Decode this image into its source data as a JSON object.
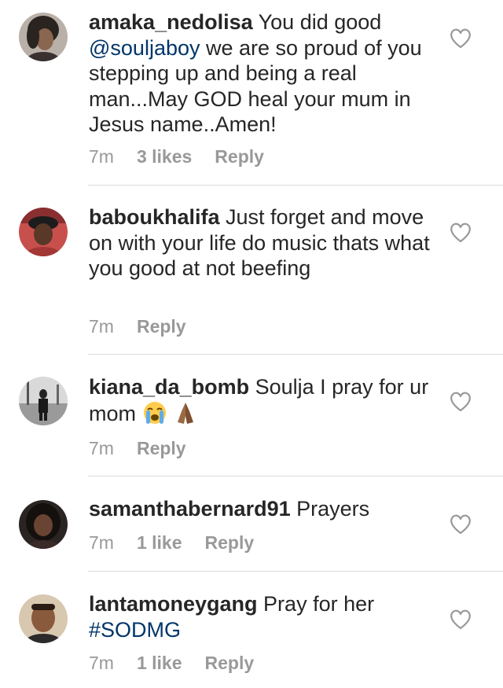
{
  "comments": [
    {
      "username": "amaka_nedolisa",
      "text_before": " You did good ",
      "mention": "@souljaboy",
      "text_after": " we are so proud of you stepping up and being a real man...May GOD heal your mum in Jesus name..Amen!",
      "time": "7m",
      "likes": "3 likes",
      "reply": "Reply"
    },
    {
      "username": "baboukhalifa",
      "text": " Just forget and move on with your life do music thats what you good at not beefing",
      "time": "7m",
      "reply": "Reply"
    },
    {
      "username": "kiana_da_bomb",
      "text": " Soulja I pray for ur mom",
      "emojis": [
        "crying-face",
        "folded-hands"
      ],
      "time": "7m",
      "reply": "Reply"
    },
    {
      "username": "samanthabernard91",
      "text": " Prayers",
      "time": "7m",
      "likes": "1 like",
      "reply": "Reply"
    },
    {
      "username": "lantamoneygang",
      "text": " Pray for her ",
      "hashtag": "#SODMG",
      "time": "7m",
      "likes": "1 like",
      "reply": "Reply"
    }
  ],
  "colors": {
    "text": "#262626",
    "link": "#003569",
    "meta": "#999999",
    "divider": "#dbdbdb"
  }
}
